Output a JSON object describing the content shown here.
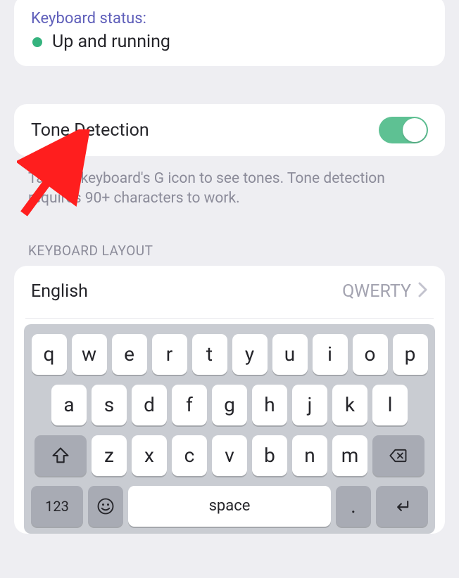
{
  "status": {
    "label": "Keyboard status:",
    "text": "Up and running"
  },
  "toneDetection": {
    "label": "Tone Detection",
    "help": "Tap the keyboard's G icon to see tones. Tone detection requires 90+ characters to work."
  },
  "sectionHeader": "KEYBOARD LAYOUT",
  "layout": {
    "language": "English",
    "value": "QWERTY"
  },
  "keyboard": {
    "row1": [
      "q",
      "w",
      "e",
      "r",
      "t",
      "y",
      "u",
      "i",
      "o",
      "p"
    ],
    "row2": [
      "a",
      "s",
      "d",
      "f",
      "g",
      "h",
      "j",
      "k",
      "l"
    ],
    "row3": [
      "z",
      "x",
      "c",
      "v",
      "b",
      "n",
      "m"
    ],
    "numKey": "123",
    "space": "space",
    "period": "."
  }
}
